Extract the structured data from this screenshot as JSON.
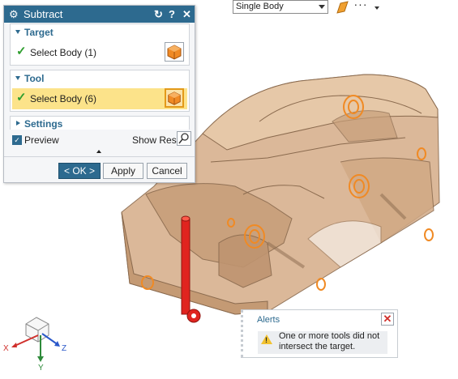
{
  "toolbar": {
    "selection_filter": "Single Body",
    "face_icon": "face-select-icon",
    "more_label": "···"
  },
  "dialog": {
    "title": "Subtract",
    "target": {
      "header": "Target",
      "select_label": "Select Body (1)"
    },
    "tool": {
      "header": "Tool",
      "select_label": "Select Body (6)"
    },
    "settings": {
      "header": "Settings"
    },
    "preview_label": "Preview",
    "show_result_label": "Show Result",
    "buttons": {
      "ok": "< OK >",
      "apply": "Apply",
      "cancel": "Cancel"
    }
  },
  "triad": {
    "x": "X",
    "y": "Y",
    "z": "Z"
  },
  "alerts": {
    "header": "Alerts",
    "message": "One or more tools did not intersect the target."
  },
  "colors": {
    "accent": "#2d6a8f",
    "highlight": "#fce38a",
    "body": "#d7b08c",
    "tool_feature": "#f08a24",
    "error": "#d0302c"
  }
}
